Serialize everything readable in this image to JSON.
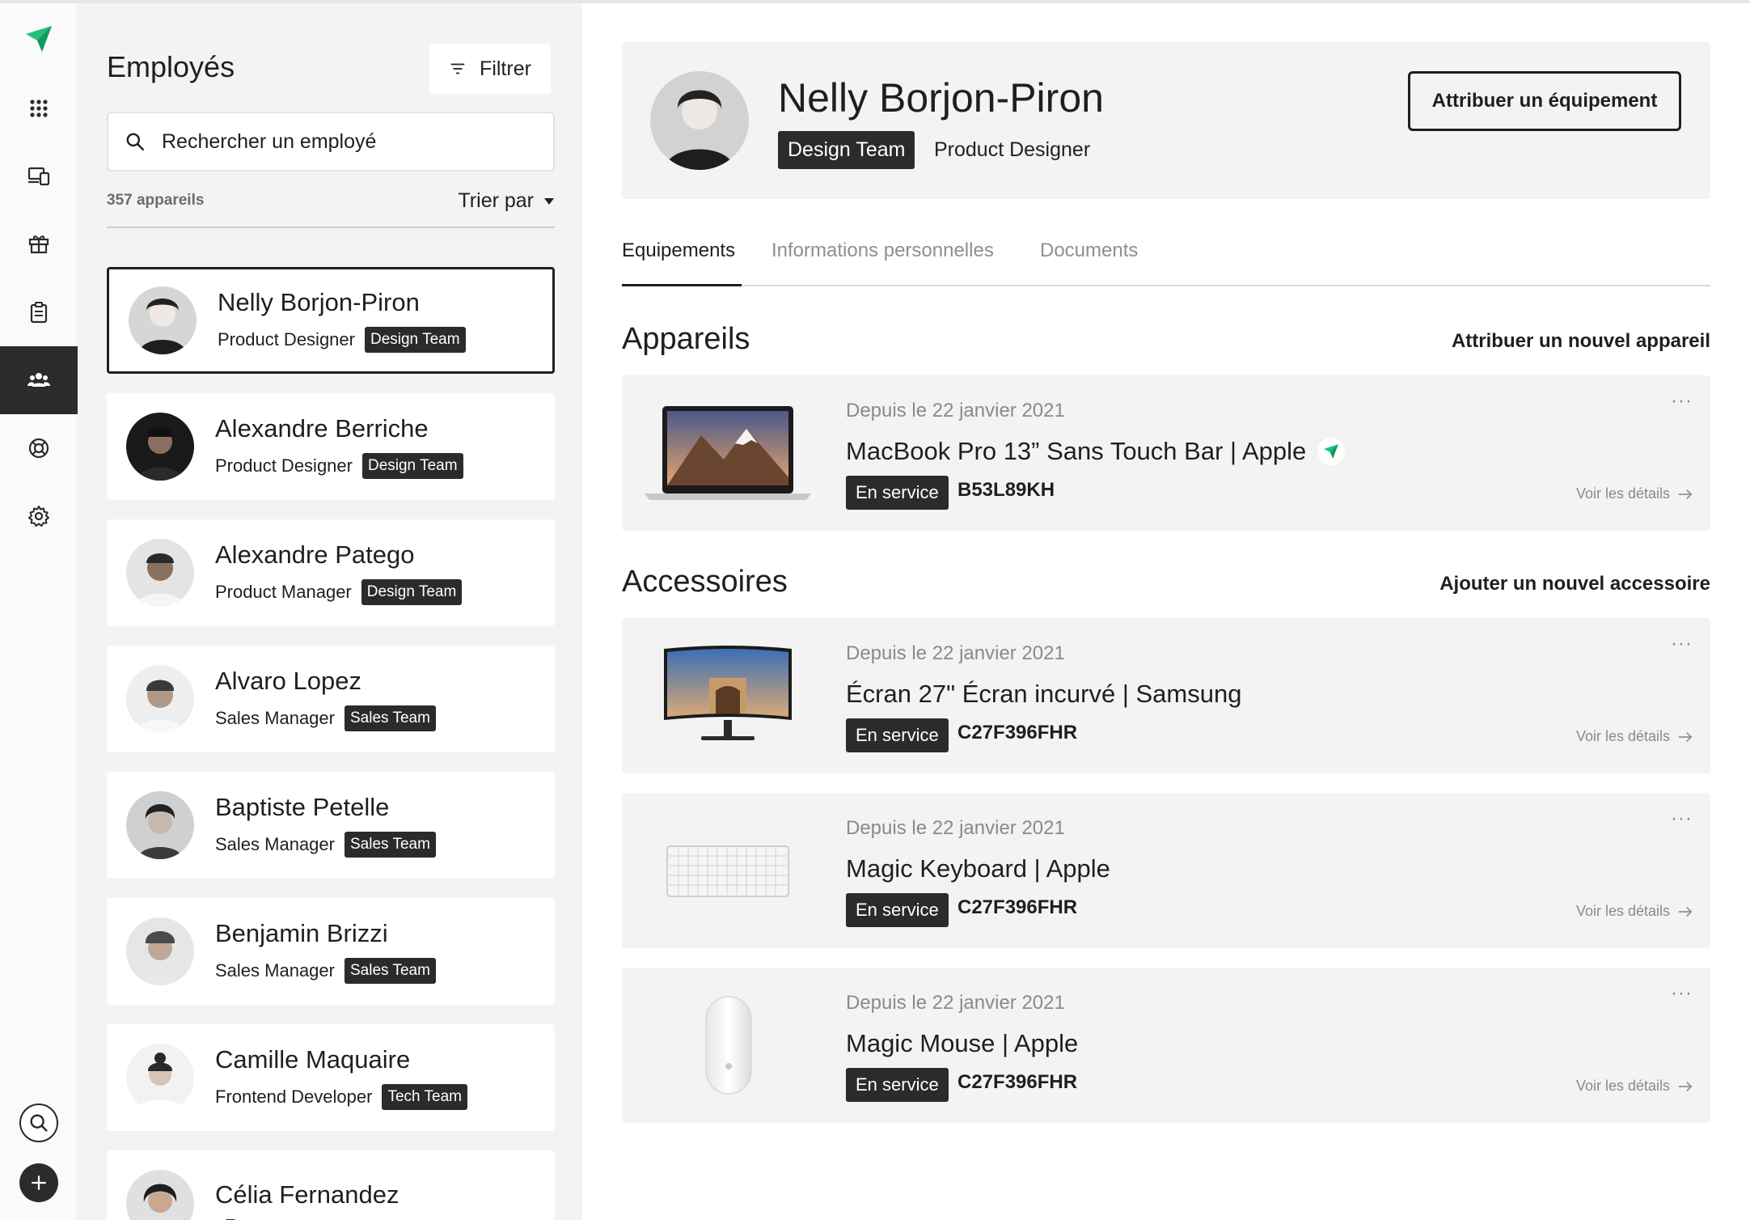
{
  "colors": {
    "accent": "#1fc17b",
    "dark": "#2b2b2b",
    "panel": "#f3f3f3",
    "muted": "#8a8a8a"
  },
  "rail": {
    "items": [
      {
        "icon": "grid-icon"
      },
      {
        "icon": "devices-icon"
      },
      {
        "icon": "box-icon"
      },
      {
        "icon": "clipboard-icon"
      },
      {
        "icon": "users-icon",
        "active": true
      },
      {
        "icon": "lifebuoy-icon"
      },
      {
        "icon": "gear-icon"
      }
    ]
  },
  "list": {
    "title": "Employés",
    "filter_label": "Filtrer",
    "search_placeholder": "Rechercher un employé",
    "count": "357 appareils",
    "sort_label": "Trier par",
    "employees": [
      {
        "name": "Nelly Borjon-Piron",
        "role": "Product Designer",
        "team": "Design Team"
      },
      {
        "name": "Alexandre Berriche",
        "role": "Product Designer",
        "team": "Design Team"
      },
      {
        "name": "Alexandre Patego",
        "role": "Product Manager",
        "team": "Design Team"
      },
      {
        "name": "Alvaro Lopez",
        "role": "Sales Manager",
        "team": "Sales Team"
      },
      {
        "name": "Baptiste Petelle",
        "role": "Sales Manager",
        "team": "Sales Team"
      },
      {
        "name": "Benjamin Brizzi",
        "role": "Sales Manager",
        "team": "Sales Team"
      },
      {
        "name": "Camille Maquaire",
        "role": "Frontend Developer",
        "team": "Tech Team"
      },
      {
        "name": "Célia Fernandez",
        "role": "",
        "team": ""
      }
    ]
  },
  "profile": {
    "name": "Nelly Borjon-Piron",
    "team": "Design Team",
    "role": "Product Designer",
    "assign_label": "Attribuer un équipement"
  },
  "tabs": [
    "Equipements",
    "Informations personnelles",
    "Documents"
  ],
  "devices_section": {
    "title": "Appareils",
    "action": "Attribuer un nouvel appareil",
    "items": [
      {
        "since": "Depuis le 22 janvier 2021",
        "name": "MacBook Pro 13” Sans Touch Bar | Apple",
        "status": "En service",
        "serial": "B53L89KH",
        "details": "Voir les détails"
      }
    ]
  },
  "accessories_section": {
    "title": "Accessoires",
    "action": "Ajouter un nouvel accessoire",
    "items": [
      {
        "since": "Depuis le 22 janvier 2021",
        "name": "Écran 27\" Écran incurvé | Samsung",
        "status": "En service",
        "serial": "C27F396FHR",
        "details": "Voir les détails"
      },
      {
        "since": "Depuis le 22 janvier 2021",
        "name": "Magic Keyboard | Apple",
        "status": "En service",
        "serial": "C27F396FHR",
        "details": "Voir les détails"
      },
      {
        "since": "Depuis le 22 janvier 2021",
        "name": "Magic Mouse | Apple",
        "status": "En service",
        "serial": "C27F396FHR",
        "details": "Voir les détails"
      }
    ]
  },
  "more_symbol": "···"
}
